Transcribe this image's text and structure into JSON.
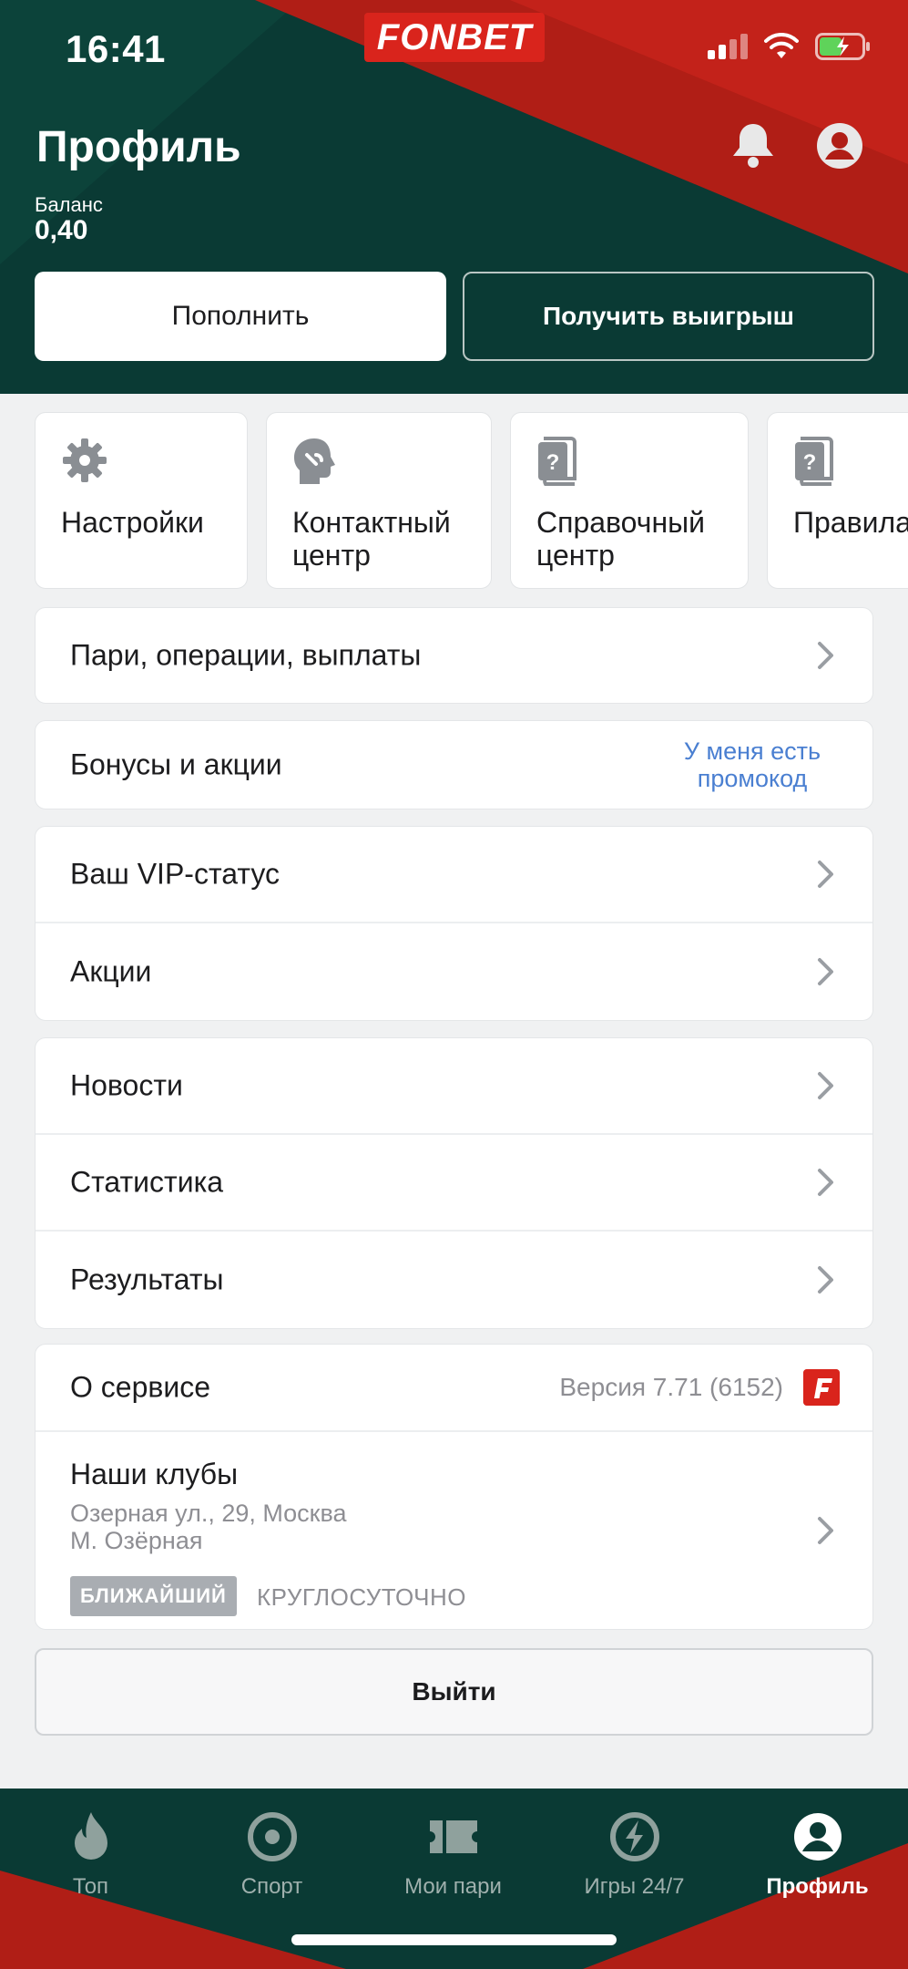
{
  "status_bar": {
    "time": "16:41"
  },
  "brand": {
    "logo_text": "FONBET",
    "red": "#d9241c",
    "green": "#0a3a34"
  },
  "header": {
    "title": "Профиль",
    "balance_label": "Баланс",
    "balance_value": "0,40",
    "deposit_label": "Пополнить",
    "withdraw_label": "Получить выигрыш",
    "icons": [
      "bell-icon",
      "user-icon"
    ]
  },
  "tiles": [
    {
      "label": "Настройки",
      "icon": "gear-icon"
    },
    {
      "label": "Контактный центр",
      "icon": "support-head-icon"
    },
    {
      "label": "Справочный центр",
      "icon": "help-book-icon"
    },
    {
      "label": "Правила",
      "icon": "help-book-icon"
    }
  ],
  "rows": {
    "bets": "Пари, операции, выплаты",
    "bonuses": "Бонусы и акции",
    "promo_link": "У меня есть промокод",
    "vip": "Ваш VIP-статус",
    "promotions": "Акции",
    "news": "Новости",
    "statistics": "Статистика",
    "results": "Результаты",
    "about": "О сервисе",
    "version": "Версия 7.71 (6152)"
  },
  "clubs": {
    "title": "Наши клубы",
    "address_line1": "Озерная ул., 29, Москва",
    "address_line2": "М. Озёрная",
    "badge": "БЛИЖАЙШИЙ",
    "hours": "КРУГЛОСУТОЧНО"
  },
  "logout_label": "Выйти",
  "tabbar": [
    {
      "label": "Топ",
      "icon": "flame-icon",
      "active": false
    },
    {
      "label": "Спорт",
      "icon": "target-icon",
      "active": false
    },
    {
      "label": "Мои пари",
      "icon": "ticket-icon",
      "active": false
    },
    {
      "label": "Игры 24/7",
      "icon": "lightning-icon",
      "active": false
    },
    {
      "label": "Профиль",
      "icon": "profile-icon",
      "active": true
    }
  ]
}
